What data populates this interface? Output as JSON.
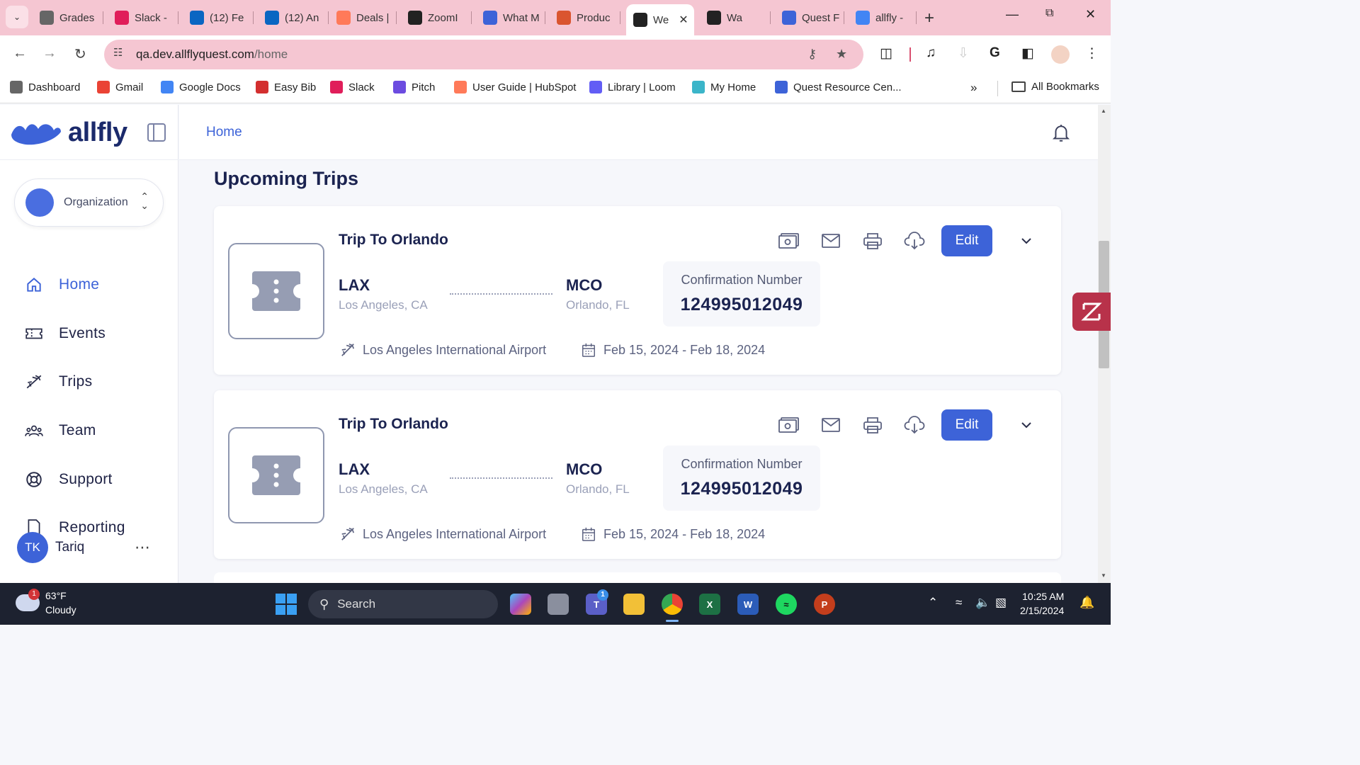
{
  "browser": {
    "tabs": [
      {
        "label": "Grades",
        "icon": "gear-favicon",
        "color": "#666666"
      },
      {
        "label": "Slack -",
        "icon": "slack-favicon",
        "color": "#e01e5a"
      },
      {
        "label": "(12) Fe",
        "icon": "linkedin-favicon",
        "color": "#0a66c2"
      },
      {
        "label": "(12) An",
        "icon": "linkedin-favicon",
        "color": "#0a66c2"
      },
      {
        "label": "Deals |",
        "icon": "hubspot-favicon",
        "color": "#ff7a59"
      },
      {
        "label": "ZoomI",
        "icon": "zoominfo-favicon",
        "color": "#222222"
      },
      {
        "label": "What M",
        "icon": "allfly-favicon",
        "color": "#3d63d8"
      },
      {
        "label": "Produc",
        "icon": "producthunt-favicon",
        "color": "#da552f"
      },
      {
        "label": "We",
        "icon": "angular-favicon",
        "color": "#222222",
        "active": true
      },
      {
        "label": "Wa",
        "icon": "amazon-favicon",
        "color": "#222222"
      },
      {
        "label": "Quest F",
        "icon": "allfly-favicon",
        "color": "#3d63d8"
      },
      {
        "label": "allfly -",
        "icon": "google-favicon",
        "color": "#4285f4"
      }
    ],
    "url_host": "qa.dev.allflyquest.com",
    "url_path": "/home",
    "bookmarks": [
      {
        "label": "Dashboard",
        "icon": "gear-favicon",
        "color": "#666666"
      },
      {
        "label": "Gmail",
        "icon": "gmail-favicon",
        "color": "#ea4335"
      },
      {
        "label": "Google Docs",
        "icon": "docs-favicon",
        "color": "#4285f4"
      },
      {
        "label": "Easy Bib",
        "icon": "easybib-favicon",
        "color": "#d32f2f"
      },
      {
        "label": "Slack",
        "icon": "slack-favicon",
        "color": "#e01e5a"
      },
      {
        "label": "Pitch",
        "icon": "pitch-favicon",
        "color": "#6c4ce0"
      },
      {
        "label": "User Guide | HubSpot",
        "icon": "hubspot-favicon",
        "color": "#ff7a59"
      },
      {
        "label": "Library | Loom",
        "icon": "loom-favicon",
        "color": "#625df5"
      },
      {
        "label": "My Home",
        "icon": "myhome-favicon",
        "color": "#3bb5c9"
      },
      {
        "label": "Quest Resource Cen...",
        "icon": "allfly-favicon",
        "color": "#3d63d8"
      }
    ],
    "all_bookmarks_label": "All Bookmarks"
  },
  "app": {
    "logo_text": "allfly",
    "org_label": "Organization",
    "nav": [
      {
        "label": "Home",
        "icon": "home-icon",
        "active": true
      },
      {
        "label": "Events",
        "icon": "ticket-icon"
      },
      {
        "label": "Trips",
        "icon": "plane-icon"
      },
      {
        "label": "Team",
        "icon": "team-icon"
      },
      {
        "label": "Support",
        "icon": "lifebuoy-icon"
      },
      {
        "label": "Reporting",
        "icon": "document-icon"
      }
    ],
    "user": {
      "initials": "TK",
      "name": "Tariq"
    },
    "breadcrumb": "Home",
    "page_title": "Upcoming Trips",
    "trips": [
      {
        "name": "Trip To Orlando",
        "origin_code": "LAX",
        "origin_city": "Los Angeles, CA",
        "dest_code": "MCO",
        "dest_city": "Orlando, FL",
        "confirmation_label": "Confirmation Number",
        "confirmation_number": "124995012049",
        "airport": "Los Angeles International Airport",
        "dates": "Feb 15, 2024 - Feb 18, 2024",
        "edit_label": "Edit"
      },
      {
        "name": "Trip To Orlando",
        "origin_code": "LAX",
        "origin_city": "Los Angeles, CA",
        "dest_code": "MCO",
        "dest_city": "Orlando, FL",
        "confirmation_label": "Confirmation Number",
        "confirmation_number": "124995012049",
        "airport": "Los Angeles International Airport",
        "dates": "Feb 15, 2024 - Feb 18, 2024",
        "edit_label": "Edit"
      }
    ],
    "colors": {
      "accent": "#3d63d8",
      "title": "#1b2350",
      "tabstrip": "#f5c6d2"
    }
  },
  "taskbar": {
    "weather_temp": "63°F",
    "weather_desc": "Cloudy",
    "weather_badge": "1",
    "search_placeholder": "Search",
    "teams_badge": "1",
    "time": "10:25 AM",
    "date": "2/15/2024"
  }
}
